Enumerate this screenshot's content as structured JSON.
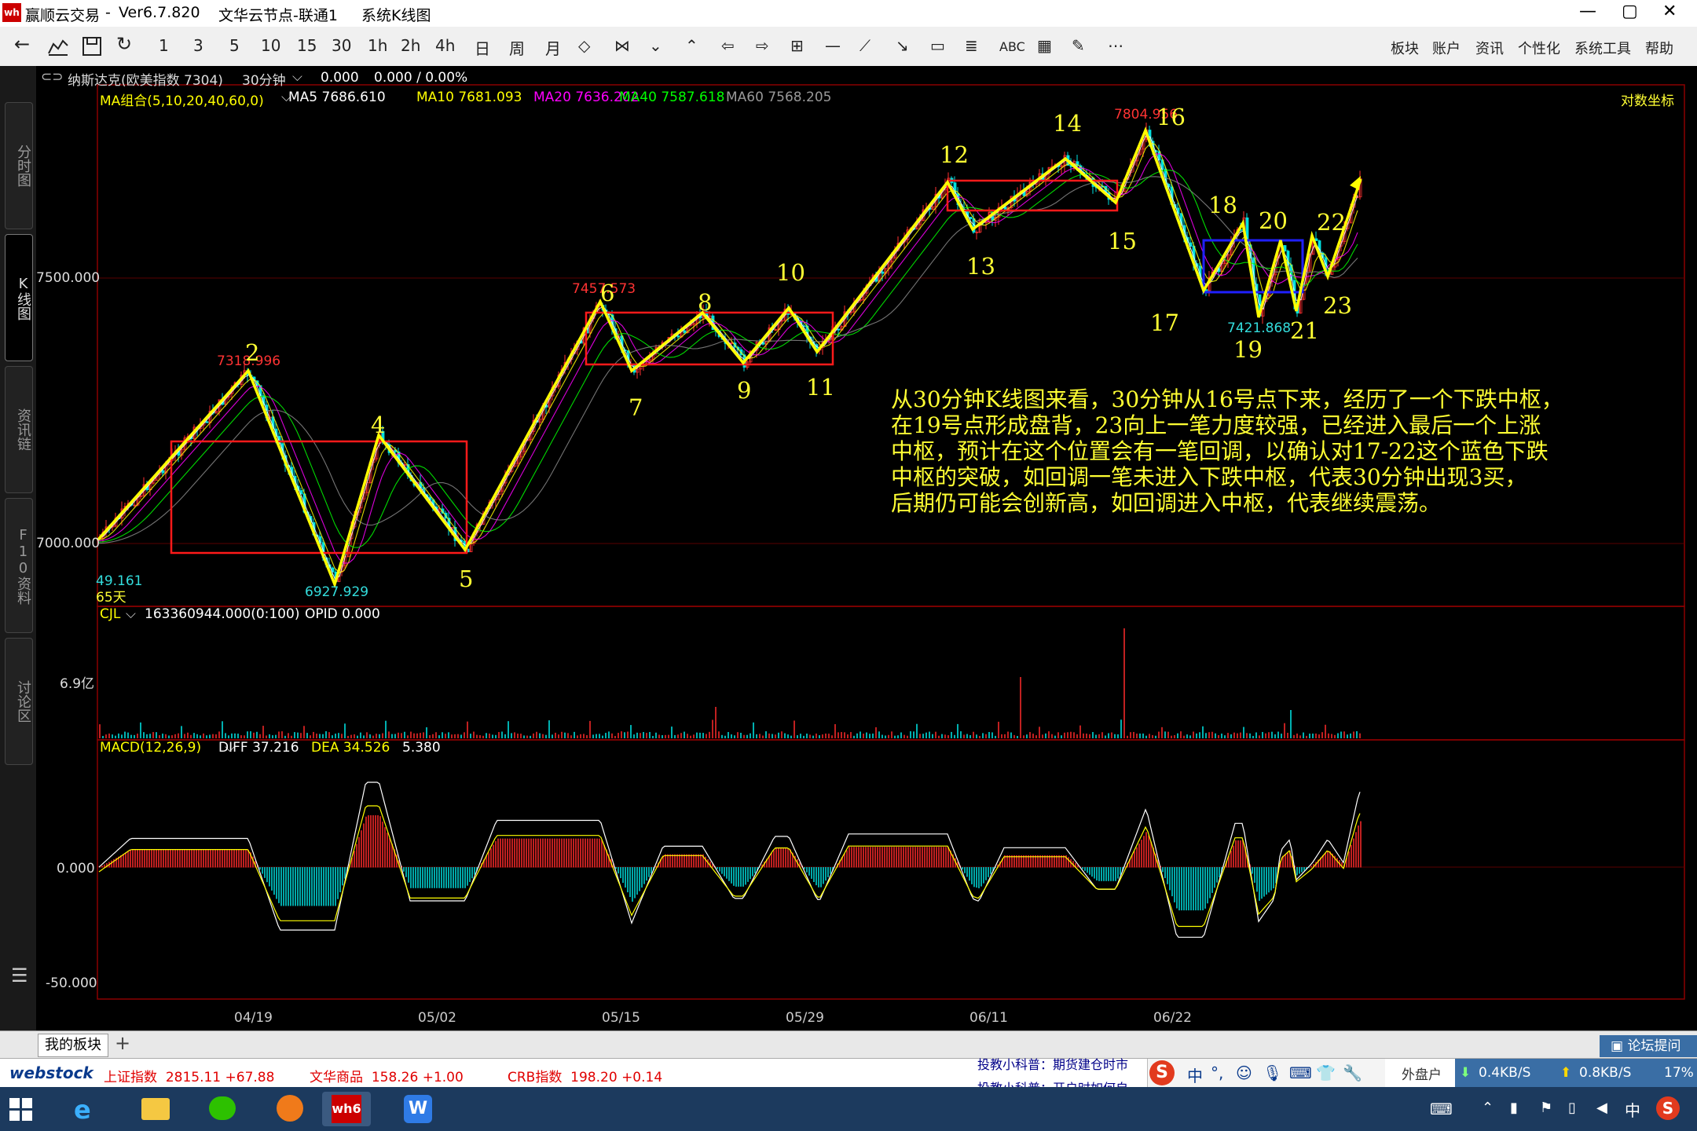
{
  "window": {
    "app_name": "赢顺云交易",
    "version": "Ver6.7.820",
    "node": "文华云节点-联通1",
    "view": "系统K线图",
    "controls": [
      "—",
      "▢",
      "✕"
    ]
  },
  "toolbar": {
    "periods": [
      "1",
      "3",
      "5",
      "10",
      "15",
      "30",
      "1h",
      "2h",
      "4h",
      "日",
      "周",
      "月"
    ],
    "abc_label": "ABC",
    "menu": [
      "板块",
      "账户",
      "资讯",
      "个性化",
      "系统工具",
      "帮助"
    ]
  },
  "left_tabs": [
    "分时图",
    "K线图",
    "资讯链",
    "F10资料",
    "讨论区"
  ],
  "chart_header": {
    "instrument": "纳斯达克(欧美指数 7304)",
    "period": "30分钟",
    "price": "0.000",
    "change": "0.000 / 0.00%",
    "coord_mode": "对数坐标"
  },
  "ma_legend": {
    "title": "MA组合(5,10,20,40,60,0)",
    "items": [
      {
        "label": "MA5 7686.610",
        "color": "#ffffff"
      },
      {
        "label": "MA10 7681.093",
        "color": "#ffff00"
      },
      {
        "label": "MA20 7636.202",
        "color": "#ff00ff"
      },
      {
        "label": "MA40 7587.618",
        "color": "#00ff00"
      },
      {
        "label": "MA60 7568.205",
        "color": "#999999"
      }
    ]
  },
  "price_axis": [
    "7500.000",
    "7000.000"
  ],
  "volume_panel": {
    "title": "CJL",
    "value": "163360944.000(0:100)",
    "opid": "OPID 0.000",
    "axis": "6.9亿"
  },
  "macd_panel": {
    "title": "MACD(12,26,9)",
    "diff": "DIFF 37.216",
    "dea": "DEA 34.526",
    "macd": "5.380",
    "axis": [
      "0.000",
      "-50.000"
    ]
  },
  "date_axis": [
    "04/19",
    "05/02",
    "05/15",
    "05/29",
    "06/11",
    "06/22"
  ],
  "price_labels": [
    {
      "text": "7318.996",
      "color": "#ff3333"
    },
    {
      "text": "6927.929",
      "color": "#33dddd"
    },
    {
      "text": "7457.573",
      "color": "#ff3333"
    },
    {
      "text": "7804.956",
      "color": "#ff3333"
    },
    {
      "text": "7421.868",
      "color": "#33dddd"
    },
    {
      "text": "49.161",
      "color": "#33dddd"
    },
    {
      "text": "65天",
      "color": "#ffff33"
    }
  ],
  "wave_labels": [
    "2",
    "4",
    "5",
    "6",
    "7",
    "8",
    "9",
    "10",
    "11",
    "12",
    "13",
    "14",
    "15",
    "16",
    "17",
    "18",
    "19",
    "20",
    "21",
    "22",
    "23"
  ],
  "annotation": [
    "从30分钟K线图来看，30分钟从16号点下来，经历了一个下跌中枢，",
    "在19号点形成盘背，23向上一笔力度较强，已经进入最后一个上涨",
    "中枢，预计在这个位置会有一笔回调，以确认对17-22这个蓝色下跌",
    "中枢的突破，如回调一笔未进入下跌中枢，代表30分钟出现3买，",
    "后期仍可能会创新高，如回调进入中枢，代表继续震荡。"
  ],
  "block_tabs": {
    "tab": "我的板块",
    "add": "+",
    "forum": "论坛提问"
  },
  "status_bar": {
    "logo": "webstock",
    "items": [
      {
        "name": "上证指数",
        "value": "2815.11",
        "change": "+67.88"
      },
      {
        "name": "文华商品",
        "value": "158.26",
        "change": "+1.00"
      },
      {
        "name": "CRB指数",
        "value": "198.20",
        "change": "+0.14"
      }
    ],
    "news1": "投教小科普：期货建仓时市",
    "news2": "投教小科普：开户时如何自",
    "outer": "外盘户",
    "net_down": "0.4KB/S",
    "net_up": "0.8KB/S",
    "cpu": "17%"
  },
  "ime": {
    "lang": "中",
    "half": "中"
  }
}
